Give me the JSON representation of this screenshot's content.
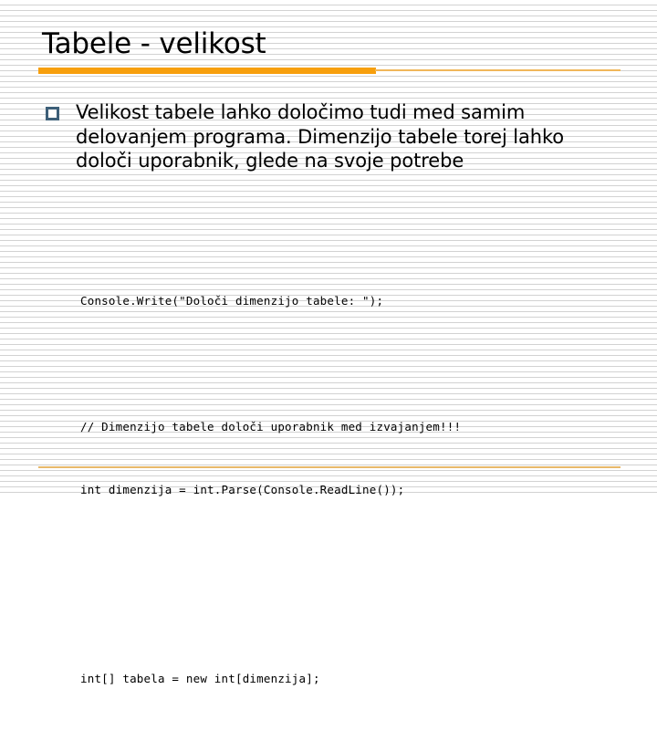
{
  "slide": {
    "title": "Tabele - velikost",
    "accent_color": "#f79f0d",
    "accent_light_color": "#f0b75a",
    "footer_rule_color": "#e8b96b",
    "bullet_marker_color": "#3d5f78",
    "background_color": "#ffffff",
    "text_color": "#000000"
  },
  "body": {
    "bullets": [
      {
        "marker": "hollow-square-bullet",
        "text": "Velikost tabele lahko določimo tudi med samim delovanjem programa. Dimenzijo tabele torej lahko določi uporabnik, glede na svoje potrebe"
      }
    ]
  },
  "code": {
    "lines": [
      "Console.Write(\"Določi dimenzijo tabele: \");",
      "",
      "// Dimenzijo tabele določi uporabnik med izvajanjem!!!",
      "int dimenzija = int.Parse(Console.ReadLine());",
      "",
      "",
      "int[] tabela = new int[dimenzija];"
    ]
  }
}
